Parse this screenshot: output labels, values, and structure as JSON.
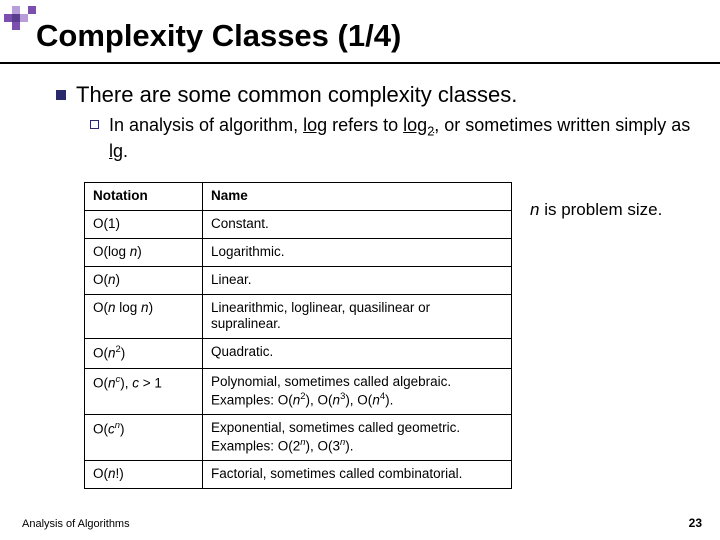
{
  "title": "Complexity Classes (1/4)",
  "bullet1": "There are some common complexity classes.",
  "bullet2_pre": "In analysis of algorithm, ",
  "bullet2_u1": "log",
  "bullet2_mid": " refers to ",
  "bullet2_u2a": "log",
  "bullet2_u2b": "2",
  "bullet2_post1": ", or sometimes written simply as ",
  "bullet2_u3": "lg",
  "bullet2_post2": ".",
  "headers": {
    "col1": "Notation",
    "col2": "Name"
  },
  "rows": [
    {
      "n": "O(1)",
      "d": "Constant."
    },
    {
      "n": [
        "O(log ",
        "n",
        ")"
      ],
      "d": "Logarithmic."
    },
    {
      "n": [
        "O(",
        "n",
        ")"
      ],
      "d": "Linear."
    },
    {
      "n": [
        "O(",
        "n",
        " log ",
        "n",
        ")"
      ],
      "d": "Linearithmic, loglinear, quasilinear or supralinear."
    },
    {
      "n": [
        "O(",
        "n",
        "2",
        ")"
      ],
      "d": "Quadratic."
    },
    {
      "n": [
        "O(",
        "n",
        "c",
        "), ",
        "c",
        " > 1"
      ],
      "d_pre": "Polynomial, sometimes called algebraic. Examples: O(",
      "d_parts": [
        "n",
        "2",
        "), O(",
        "n",
        "3",
        "), O(",
        "n",
        "4",
        ")."
      ]
    },
    {
      "n": [
        "O(",
        "c",
        "n",
        ")"
      ],
      "d_pre": "Exponential, sometimes called geometric.",
      "d_parts": [
        " Examples: O(2",
        "n",
        "), O(3",
        "n",
        ")."
      ]
    },
    {
      "n": [
        "O(",
        "n",
        "!)"
      ],
      "d": "Factorial, sometimes called combinatorial."
    }
  ],
  "sidenote_i": "n",
  "sidenote_rest": " is problem size.",
  "footer_left": "Analysis of Algorithms",
  "footer_right": "23",
  "chart_data": {
    "type": "table",
    "title": "Complexity Classes (1/4)",
    "columns": [
      "Notation",
      "Name"
    ],
    "rows": [
      [
        "O(1)",
        "Constant."
      ],
      [
        "O(log n)",
        "Logarithmic."
      ],
      [
        "O(n)",
        "Linear."
      ],
      [
        "O(n log n)",
        "Linearithmic, loglinear, quasilinear or supralinear."
      ],
      [
        "O(n^2)",
        "Quadratic."
      ],
      [
        "O(n^c), c > 1",
        "Polynomial, sometimes called algebraic. Examples: O(n^2), O(n^3), O(n^4)."
      ],
      [
        "O(c^n)",
        "Exponential, sometimes called geometric. Examples: O(2^n), O(3^n)."
      ],
      [
        "O(n!)",
        "Factorial, sometimes called combinatorial."
      ]
    ]
  }
}
